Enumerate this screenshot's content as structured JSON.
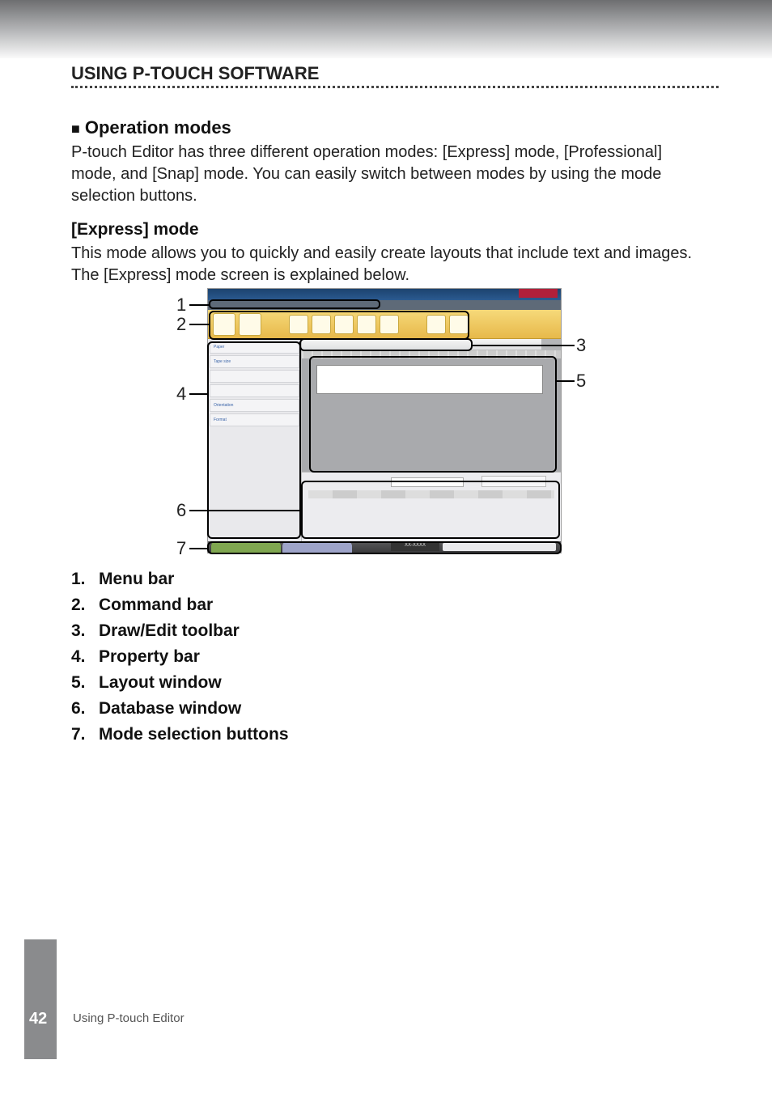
{
  "header": {
    "section_title": "USING P-TOUCH SOFTWARE"
  },
  "op_modes": {
    "heading": "Operation modes",
    "body": "P-touch Editor has three different operation modes: [Express] mode, [Professional] mode, and [Snap] mode. You can easily switch between modes by using the mode selection buttons."
  },
  "express": {
    "heading": "[Express] mode",
    "body": "This mode allows you to quickly and easily create layouts that include text and images. The [Express] mode screen is explained below."
  },
  "callouts": {
    "n1": "1",
    "n2": "2",
    "n3": "3",
    "n4": "4",
    "n5": "5",
    "n6": "6",
    "n7": "7"
  },
  "items": [
    {
      "num": "1.",
      "label": "Menu bar"
    },
    {
      "num": "2.",
      "label": "Command bar"
    },
    {
      "num": "3.",
      "label": "Draw/Edit toolbar"
    },
    {
      "num": "4.",
      "label": "Property bar"
    },
    {
      "num": "5.",
      "label": "Layout window"
    },
    {
      "num": "6.",
      "label": "Database window"
    },
    {
      "num": "7.",
      "label": "Mode selection buttons"
    }
  ],
  "screenshot": {
    "device": "XX-XXXX"
  },
  "footer": {
    "page": "42",
    "title": "Using P-touch Editor"
  }
}
